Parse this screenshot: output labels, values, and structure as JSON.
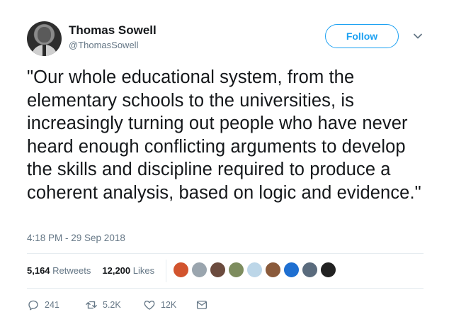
{
  "author": {
    "name": "Thomas Sowell",
    "handle": "@ThomasSowell"
  },
  "follow_label": "Follow",
  "tweet": {
    "text": "\"Our whole educational system, from the elementary schools to the universities, is increasingly turning out people who have never heard enough conflicting arguments to develop the skills and discipline required to produce a coherent analysis, based on logic and evidence.\"",
    "timestamp": "4:18 PM - 29 Sep 2018"
  },
  "stats": {
    "retweets_count": "5,164",
    "retweets_label": "Retweets",
    "likes_count": "12,200",
    "likes_label": "Likes"
  },
  "likers_colors": [
    "#d2542e",
    "#9aa5ae",
    "#6b4b3e",
    "#7d8c5e",
    "#bcd6e8",
    "#8a5a3b",
    "#1e6fd1",
    "#5a6b7d",
    "#222222"
  ],
  "actions": {
    "reply_count": "241",
    "retweet_count": "5.2K",
    "like_count": "12K"
  },
  "colors": {
    "accent": "#1da1f2",
    "muted": "#657786",
    "text": "#14171a"
  },
  "icons": [
    "chevron-down-icon",
    "reply-icon",
    "retweet-icon",
    "heart-icon",
    "message-icon"
  ]
}
